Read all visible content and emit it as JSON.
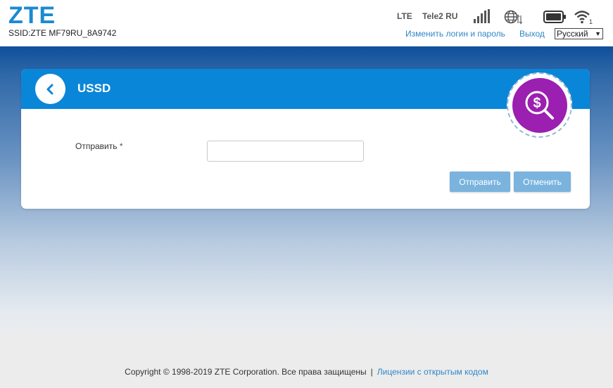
{
  "header": {
    "logo": "ZTE",
    "ssid": "SSID:ZTE MF79RU_8A9742",
    "network_type": "LTE",
    "operator": "Tele2 RU",
    "change_login_link": "Изменить логин и пароль",
    "logout_link": "Выход",
    "language": "Русский",
    "wifi_clients": "1"
  },
  "panel": {
    "title": "USSD",
    "field_label": "Отправить",
    "required_mark": "*",
    "input_value": "",
    "send_button": "Отправить",
    "cancel_button": "Отменить"
  },
  "footer": {
    "copyright": "Copyright © 1998-2019 ZTE Corporation. Все права защищены",
    "separator": "|",
    "license_link": "Лицензии с открытым кодом"
  },
  "colors": {
    "brand_blue": "#1a8ad2",
    "panel_header": "#0a86d8",
    "badge_purple": "#9b1fb0",
    "button": "#7ab3de",
    "link": "#2f86c9"
  },
  "icons": [
    "signal-bars-icon",
    "globe-data-icon",
    "battery-icon",
    "wifi-icon",
    "back-arrow-icon",
    "dollar-search-icon"
  ]
}
